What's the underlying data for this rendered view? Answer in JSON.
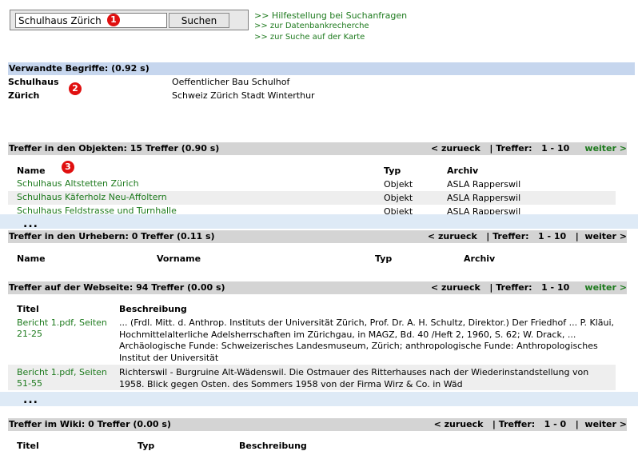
{
  "search": {
    "value": "Schulhaus Zürich",
    "button_label": "Suchen",
    "marker_1": "1"
  },
  "help_links": {
    "hilfe": ">> Hilfestellung bei Suchanfragen",
    "datenbank": ">> zur Datenbankrecherche",
    "karte": ">> zur Suche auf der Karte"
  },
  "related": {
    "header": "Verwandte Begriffe: (0.92 s)",
    "marker": "2",
    "rows": [
      {
        "term": "Schulhaus",
        "terms": "Oeffentlicher Bau Schulhof"
      },
      {
        "term": "Zürich",
        "terms": "Schweiz Zürich Stadt Winterthur"
      }
    ]
  },
  "objects": {
    "header": "Treffer in den Objekten: 15 Treffer (0.90 s)",
    "pager": {
      "prev": "< zurueck",
      "sep": "|",
      "label": "Treffer:",
      "range": "1 - 10",
      "next": "weiter >"
    },
    "marker": "3",
    "columns": [
      "Name",
      "Typ",
      "Archiv"
    ],
    "rows": [
      {
        "name": "Schulhaus Altstetten Zürich",
        "typ": "Objekt",
        "archiv": "ASLA Rapperswil"
      },
      {
        "name": "Schulhaus Käferholz Neu-Affoltern",
        "typ": "Objekt",
        "archiv": "ASLA Rapperswil"
      },
      {
        "name": "Schulhaus Feldstrasse und Turnhalle",
        "typ": "Objekt",
        "archiv": "ASLA Rapperswil"
      }
    ],
    "ellipsis": "..."
  },
  "urheber": {
    "header": "Treffer in den Urhebern: 0 Treffer (0.11 s)",
    "pager": {
      "prev": "< zurueck",
      "sep": "|",
      "label": "Treffer:",
      "range": "1 - 10",
      "sep2": "|",
      "next": "weiter >"
    },
    "columns": [
      "Name",
      "Vorname",
      "Typ",
      "Archiv"
    ]
  },
  "webseite": {
    "header": "Treffer auf der Webseite: 94 Treffer (0.00 s)",
    "pager": {
      "prev": "< zurueck",
      "sep": "|",
      "label": "Treffer:",
      "range": "1 - 10",
      "next": "weiter >"
    },
    "columns": [
      "Titel",
      "Beschreibung"
    ],
    "rows": [
      {
        "title_line1": "Bericht 1.pdf, Seiten",
        "title_line2": "21-25",
        "desc": [
          "... (Frdl. Mitt. d. Anthrop. Instituts der Universität Zürich, Prof. Dr. A. H. Schultz, Direktor.) Der Friedhof ... P. Kläui,",
          "Hochmittelalterliche Adelsherrschaften im Zürichgau, in MAGZ, Bd. 40 /Heft 2, 1960, S. 62; W. Drack, ...",
          "Archäologische Funde: Schweizerisches Landesmuseum, Zürich; anthropologische Funde: Anthropologisches",
          "Institut der Universität"
        ]
      },
      {
        "title_line1": "Bericht 1.pdf, Seiten",
        "title_line2": "51-55",
        "desc": [
          "Richterswil - Burgruine Alt-Wädenswil. Die Ostmauer des Ritterhauses nach der Wiederinstandstellung von",
          "1958. Blick gegen Osten. des Sommers 1958 von der Firma Wirz & Co. in Wäd"
        ]
      }
    ],
    "ellipsis": "..."
  },
  "wiki": {
    "header": "Treffer im Wiki: 0 Treffer (0.00 s)",
    "pager": {
      "prev": "< zurueck",
      "sep": "|",
      "label": "Treffer:",
      "range": "1 - 0",
      "sep2": "|",
      "next": "weiter >"
    },
    "columns": [
      "Titel",
      "Typ",
      "Beschreibung"
    ]
  },
  "colors": {
    "link_green": "#1d7a1d",
    "header_gray": "#d4d4d4",
    "header_blue": "#c6d6ee",
    "marker_red": "#e01010"
  }
}
